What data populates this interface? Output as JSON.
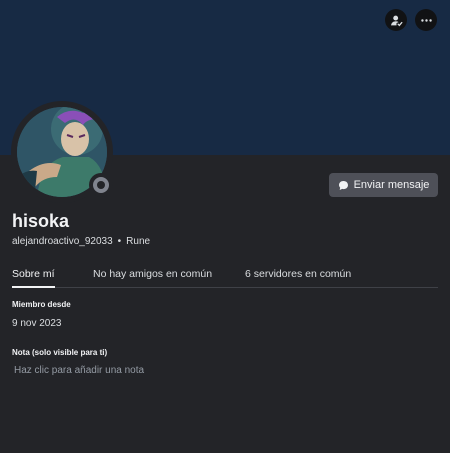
{
  "user": {
    "display_name": "hisoka",
    "username": "alejandroactivo_92033",
    "separator": "•",
    "server_tag": "Rune",
    "status": "offline"
  },
  "actions": {
    "send_message_label": "Enviar mensaje",
    "friend_icon": "add-friend-icon",
    "more_icon": "more-options-icon"
  },
  "tabs": [
    {
      "label": "Sobre mí",
      "active": true
    },
    {
      "label": "No hay amigos en común",
      "active": false
    },
    {
      "label": "6 servidores en común",
      "active": false
    }
  ],
  "about": {
    "member_since_label": "Miembro desde",
    "member_since_value": "9 nov 2023",
    "note_label": "Nota (solo visible para ti)",
    "note_placeholder": "Haz clic para añadir una nota"
  },
  "colors": {
    "banner": "#172a44",
    "background": "#232428",
    "button": "#4e5058",
    "status_offline": "#80848e"
  }
}
